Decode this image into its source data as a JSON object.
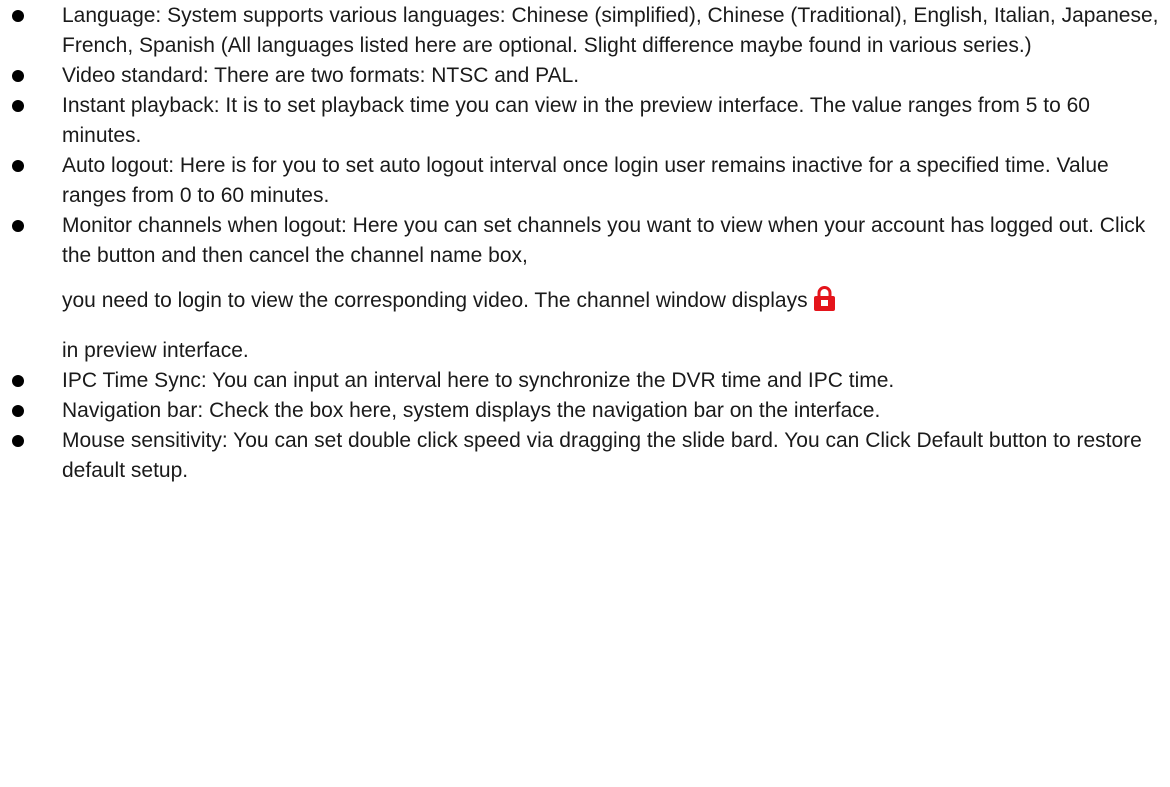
{
  "bullets": [
    {
      "text": "Language: System supports various languages: Chinese (simplified), Chinese (Traditional), English, Italian, Japanese, French, Spanish (All languages listed here are optional. Slight difference maybe found in various series.)"
    },
    {
      "text": "Video standard: There are two formats: NTSC and PAL."
    },
    {
      "text": "Instant playback: It is to set playback time you can view in the preview interface. The value ranges from 5 to 60 minutes."
    },
    {
      "text": "Auto logout: Here is for you to set auto logout interval once login user remains inactive for a specified time. Value ranges from 0 to 60 minutes."
    },
    {
      "text_part1": "Monitor channels when logout: Here you can set channels you want to view when your account has logged out. Click the button and then cancel the channel name box,",
      "text_part2": "you need to login to view the corresponding video. The channel window displays",
      "icon": "lock-icon",
      "text_part3": "in preview interface."
    },
    {
      "text": "IPC Time Sync: You can input an interval here to synchronize the DVR time and IPC time."
    },
    {
      "text": "Navigation bar: Check the box here, system displays the navigation bar on the interface."
    },
    {
      "text": "Mouse sensitivity: You can set double click speed via dragging the slide bard. You can Click Default button to restore default setup."
    }
  ],
  "colors": {
    "text": "#1a1a1a",
    "bullet": "#000000",
    "lock_icon_red": "#e4141b"
  }
}
